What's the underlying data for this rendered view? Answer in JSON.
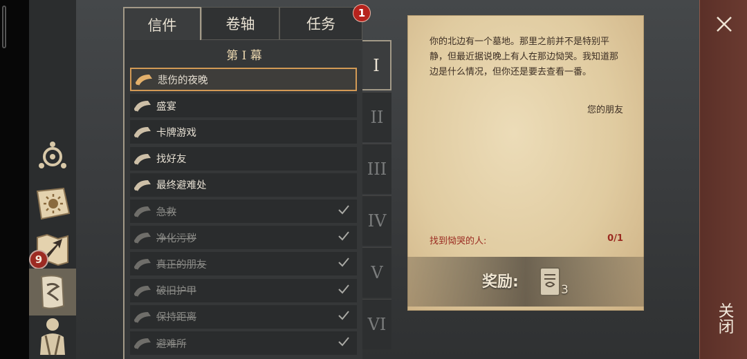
{
  "sidebar": {
    "badge_count": "9",
    "buttons": [
      "compass-icon",
      "sun-book-icon",
      "map-arrow-icon",
      "scroll-icon",
      "character-icon"
    ]
  },
  "tabs": [
    {
      "label": "信件",
      "active": true
    },
    {
      "label": "卷轴",
      "active": false
    },
    {
      "label": "任务",
      "active": false,
      "badge": "1"
    }
  ],
  "act_title": "第 I 幕",
  "letters": [
    {
      "label": "悲伤的夜晚",
      "selected": true,
      "done": false
    },
    {
      "label": "盛宴",
      "selected": false,
      "done": false
    },
    {
      "label": "卡牌游戏",
      "selected": false,
      "done": false
    },
    {
      "label": "找好友",
      "selected": false,
      "done": false
    },
    {
      "label": "最终避难处",
      "selected": false,
      "done": false
    },
    {
      "label": "急救",
      "selected": false,
      "done": true
    },
    {
      "label": "净化污秽",
      "selected": false,
      "done": true
    },
    {
      "label": "真正的朋友",
      "selected": false,
      "done": true
    },
    {
      "label": "破旧护甲",
      "selected": false,
      "done": true
    },
    {
      "label": "保持距离",
      "selected": false,
      "done": true
    },
    {
      "label": "避难所",
      "selected": false,
      "done": true
    }
  ],
  "acts": [
    {
      "label": "I",
      "active": true
    },
    {
      "label": "II",
      "active": false
    },
    {
      "label": "III",
      "active": false
    },
    {
      "label": "IV",
      "active": false
    },
    {
      "label": "V",
      "active": false
    },
    {
      "label": "VI",
      "active": false
    }
  ],
  "letter": {
    "body": "你的北边有一个墓地。那里之前并不是特别平静，但最近据说晚上有人在那边恸哭。我知道那边是什么情况，但你还是要去查看一番。",
    "signature": "您的朋友",
    "objective": "找到恸哭的人:",
    "objective_progress": "0/1",
    "reward_label": "奖励:",
    "reward_count": "3"
  },
  "close": {
    "label": "关闭"
  },
  "colors": {
    "accent_selected": "#d39a55",
    "badge_red": "#b6231d",
    "objective_red": "#9a2a20",
    "parchment": "#e0cba0"
  }
}
